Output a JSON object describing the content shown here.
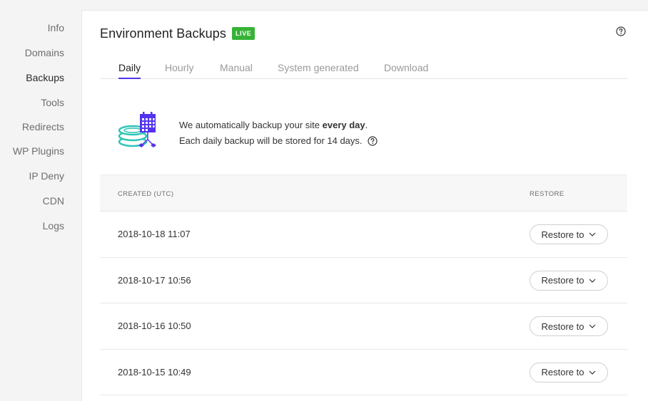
{
  "sidebar": {
    "items": [
      {
        "label": "Info",
        "active": false
      },
      {
        "label": "Domains",
        "active": false
      },
      {
        "label": "Backups",
        "active": true
      },
      {
        "label": "Tools",
        "active": false
      },
      {
        "label": "Redirects",
        "active": false
      },
      {
        "label": "WP Plugins",
        "active": false
      },
      {
        "label": "IP Deny",
        "active": false
      },
      {
        "label": "CDN",
        "active": false
      },
      {
        "label": "Logs",
        "active": false
      }
    ]
  },
  "header": {
    "title": "Environment Backups",
    "badge": "LIVE",
    "help_icon": "question-circle-icon"
  },
  "tabs": [
    {
      "label": "Daily",
      "active": true
    },
    {
      "label": "Hourly",
      "active": false
    },
    {
      "label": "Manual",
      "active": false
    },
    {
      "label": "System generated",
      "active": false
    },
    {
      "label": "Download",
      "active": false
    }
  ],
  "info": {
    "line1_prefix": "We automatically backup your site ",
    "line1_bold": "every day",
    "line1_suffix": ".",
    "line2": "Each daily backup will be stored for 14 days.",
    "illustration_icon": "database-calendar-icon"
  },
  "table": {
    "columns": [
      "CREATED (UTC)",
      "RESTORE"
    ],
    "rows": [
      {
        "created": "2018-10-18 11:07",
        "action": "Restore to"
      },
      {
        "created": "2018-10-17 10:56",
        "action": "Restore to"
      },
      {
        "created": "2018-10-16 10:50",
        "action": "Restore to"
      },
      {
        "created": "2018-10-15 10:49",
        "action": "Restore to"
      }
    ]
  },
  "colors": {
    "accent": "#5333ed",
    "live": "#36b336",
    "teal": "#2ec4b6"
  }
}
